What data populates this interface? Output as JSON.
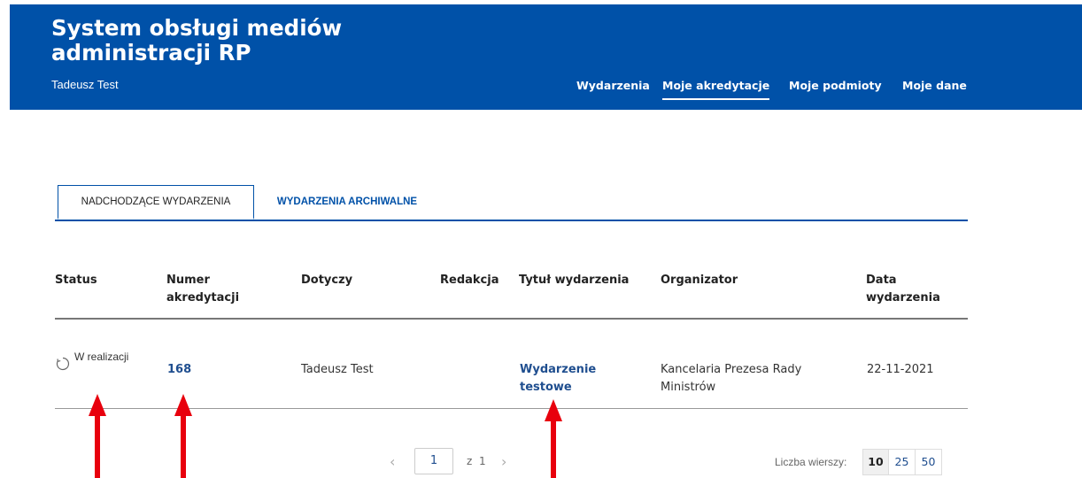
{
  "header": {
    "title": "System obsługi mediów administracji RP",
    "user": "Tadeusz Test",
    "nav": [
      {
        "label": "Wydarzenia",
        "active": false
      },
      {
        "label": "Moje akredytacje",
        "active": true
      },
      {
        "label": "Moje podmioty",
        "active": false
      },
      {
        "label": "Moje dane",
        "active": false
      }
    ]
  },
  "tabs": [
    {
      "label": "NADCHODZĄCE WYDARZENIA",
      "active": true
    },
    {
      "label": "WYDARZENIA ARCHIWALNE",
      "active": false
    }
  ],
  "table": {
    "columns": [
      "Status",
      "Numer akredytacji",
      "Dotyczy",
      "Redakcja",
      "Tytuł wydarzenia",
      "Organizator",
      "Data wydarzenia"
    ],
    "rows": [
      {
        "status": "W realizacji",
        "number": "168",
        "concerns": "Tadeusz Test",
        "editorial": "",
        "title": "Wydarzenie testowe",
        "organizer": "Kancelaria Prezesa Rady Ministrów",
        "date": "22-11-2021"
      }
    ]
  },
  "pagination": {
    "current_page": "1",
    "of_label": "z",
    "total_pages": "1",
    "rows_label": "Liczba wierszy:",
    "rows_options": [
      "10",
      "25",
      "50"
    ],
    "rows_selected": "10"
  },
  "colors": {
    "header_bg": "#0051a8",
    "link": "#1f4e8f",
    "annotation_arrow": "#e8000d"
  }
}
